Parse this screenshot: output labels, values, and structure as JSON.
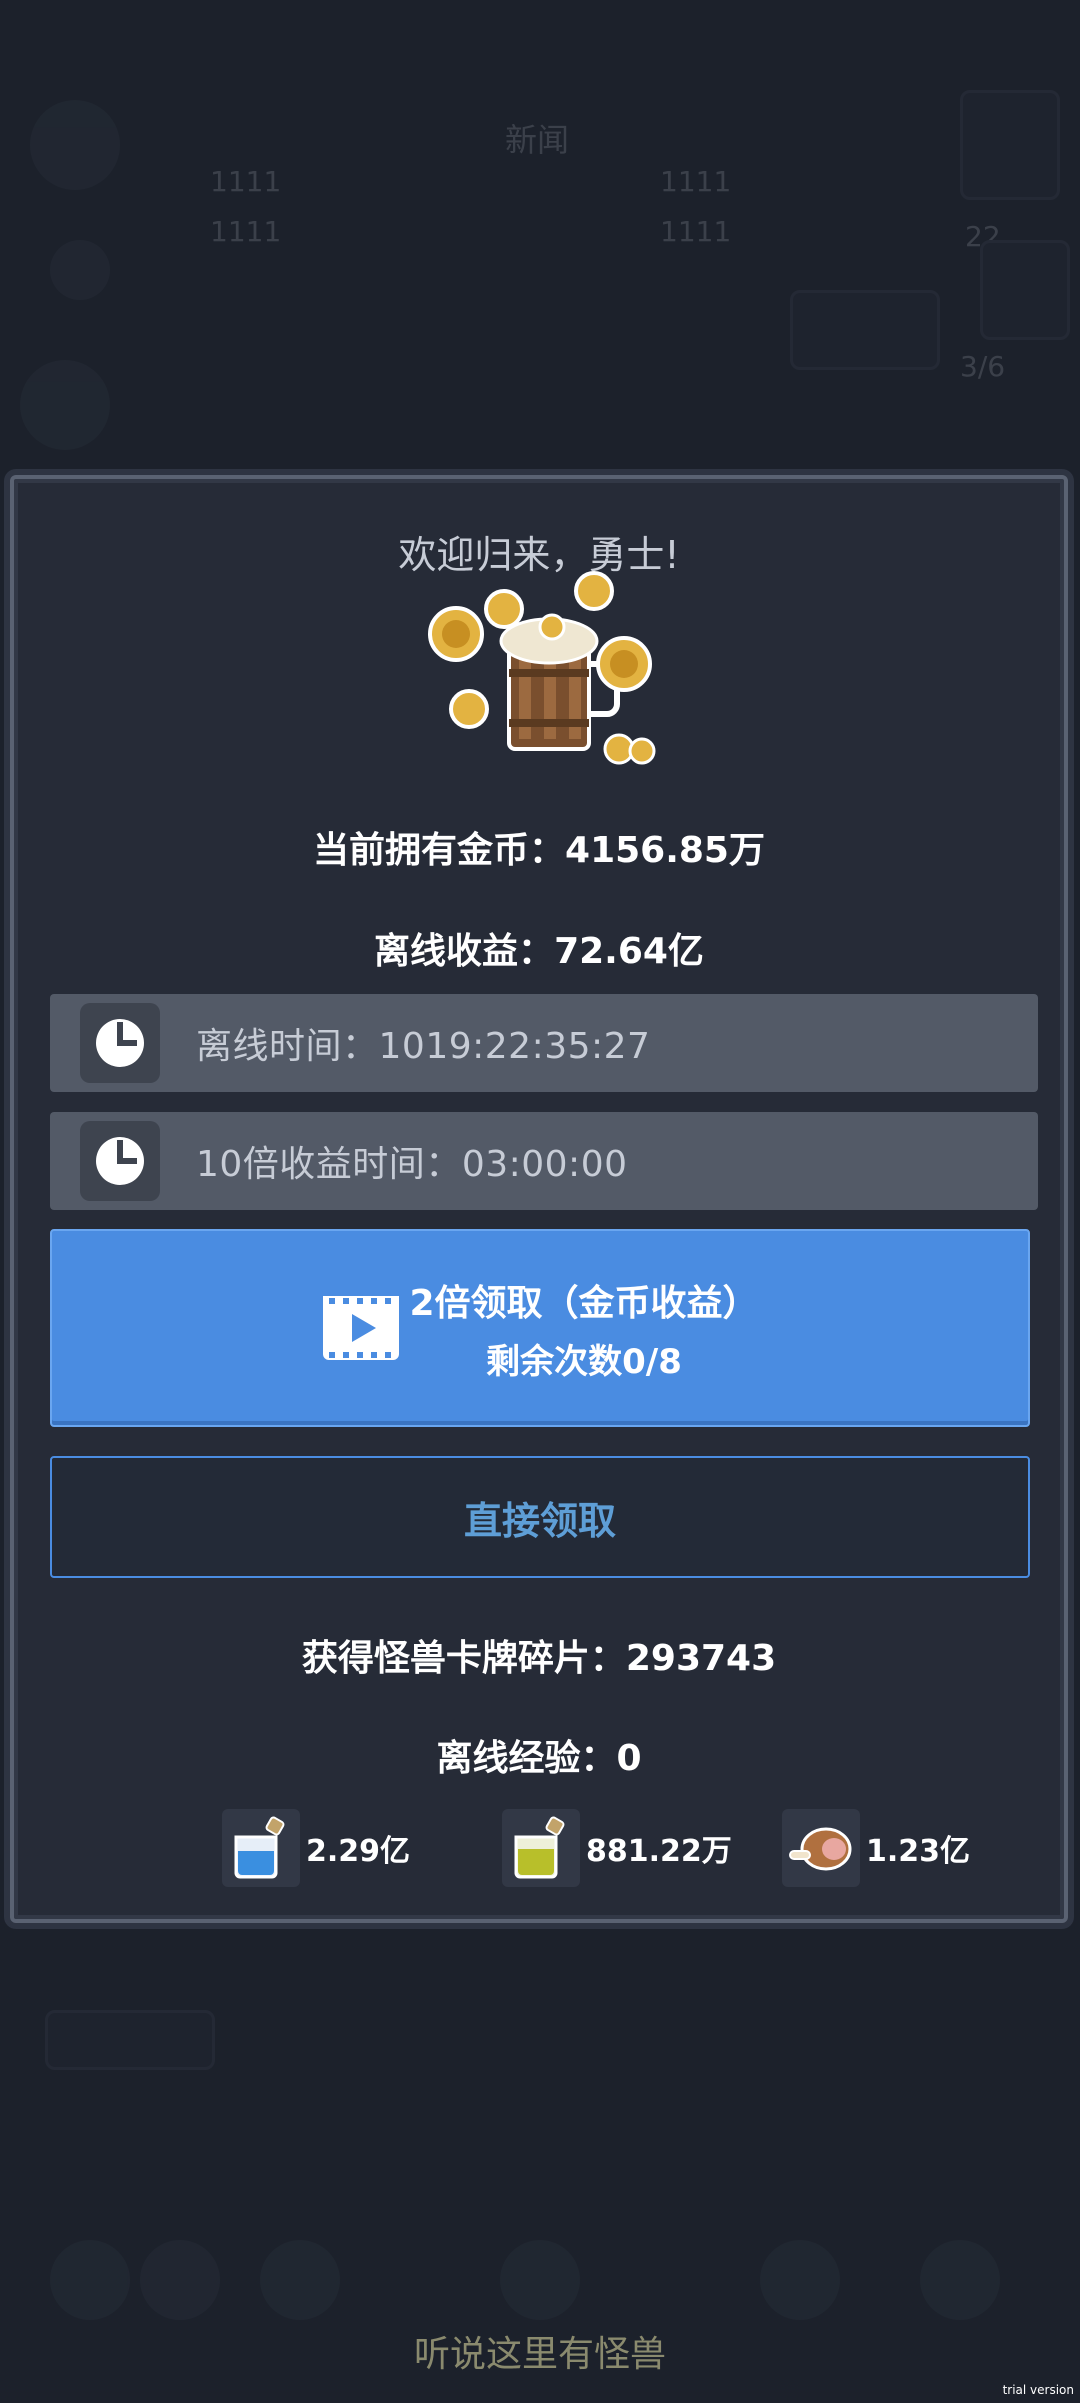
{
  "background": {
    "news_label": "新闻",
    "stat_1": "1111",
    "stat_2": "1111",
    "stat_3": "1111",
    "stat_4": "1111",
    "count_badge": "3/6",
    "level_badge": "22",
    "bottom_title": "听说这里有怪兽",
    "watermark": "trial version"
  },
  "modal": {
    "title": "欢迎归来，勇士!",
    "current_coins_label": "当前拥有金币：",
    "current_coins_value": "4156.85万",
    "offline_income_label": "离线收益：",
    "offline_income_value": "72.64亿",
    "offline_time_label": "离线时间：",
    "offline_time_value": "1019:22:35:27",
    "tenx_time_label": "10倍收益时间：",
    "tenx_time_value": "03:00:00",
    "double_button_line1": "2倍领取（金币收益）",
    "double_button_line2": "剩余次数0/8",
    "direct_button": "直接领取",
    "card_shards_label": "获得怪兽卡牌碎片：",
    "card_shards_value": "293743",
    "offline_exp_label": "离线经验：",
    "offline_exp_value": "0",
    "rewards": [
      {
        "icon": "blue-potion-icon",
        "amount": "2.29亿"
      },
      {
        "icon": "yellow-potion-icon",
        "amount": "881.22万"
      },
      {
        "icon": "meat-icon",
        "amount": "1.23亿"
      }
    ]
  },
  "colors": {
    "primary_button": "#4a8ce1",
    "panel_bg": "#262b37",
    "row_bg": "#535a67",
    "secondary_text": "#5e9ed6"
  }
}
